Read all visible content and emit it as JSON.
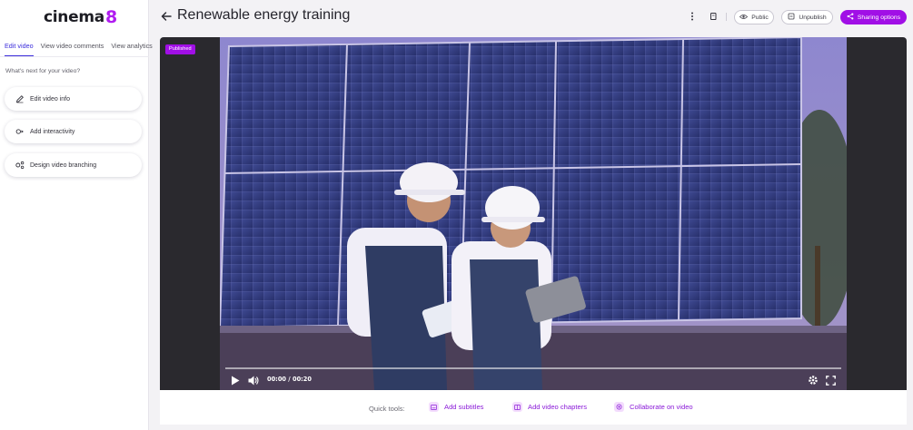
{
  "app": {
    "logo_text": "cinema",
    "logo_mark": "8"
  },
  "sidebar": {
    "tabs": [
      {
        "label": "Edit video",
        "active": true
      },
      {
        "label": "View video comments",
        "active": false
      },
      {
        "label": "View analytics",
        "active": false
      }
    ],
    "prompt": "What's next for your video?",
    "actions": [
      {
        "label": "Edit video info",
        "icon": "pencil-icon"
      },
      {
        "label": "Add interactivity",
        "icon": "interactivity-icon"
      },
      {
        "label": "Design video branching",
        "icon": "branching-icon"
      }
    ]
  },
  "header": {
    "title": "Renewable energy training",
    "buttons": {
      "public": "Public",
      "unpublish": "Unpublish",
      "sharing": "Sharing options"
    }
  },
  "player": {
    "badge": "Published",
    "time": "00:00 / 00:20",
    "progress": 0.0
  },
  "quick_tools": {
    "label": "Quick tools:",
    "items": [
      {
        "label": "Add subtitles",
        "icon": "subtitles-icon"
      },
      {
        "label": "Add video chapters",
        "icon": "chapters-icon"
      },
      {
        "label": "Collaborate on video",
        "icon": "collaborate-icon"
      }
    ]
  },
  "colors": {
    "accent": "#a10fe6",
    "tab_active": "#3b2ddb",
    "quick_link": "#8a1ad8"
  }
}
